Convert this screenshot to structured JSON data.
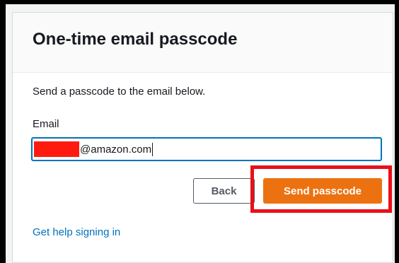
{
  "card": {
    "title": "One-time email passcode",
    "description": "Send a passcode to the email below."
  },
  "form": {
    "email_label": "Email",
    "email_value": "@amazon.com"
  },
  "buttons": {
    "back_label": "Back",
    "send_label": "Send passcode"
  },
  "links": {
    "help_label": "Get help signing in"
  },
  "colors": {
    "primary_button": "#ec7211",
    "link": "#0073bb",
    "highlight": "#e8101a",
    "redaction": "#ff1a0f"
  }
}
